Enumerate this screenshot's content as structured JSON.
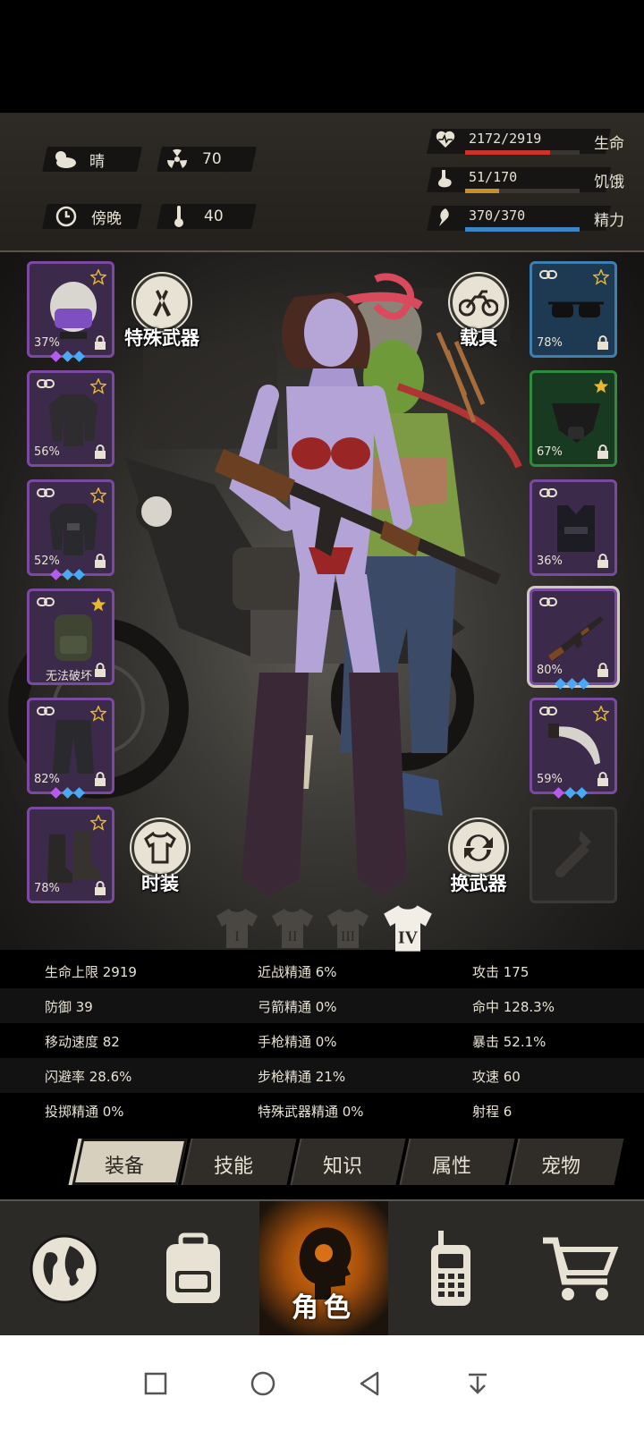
{
  "status": {
    "weather": {
      "icon": "cloud-sun-icon",
      "label": "晴"
    },
    "radiation": {
      "icon": "radiation-icon",
      "value": "70"
    },
    "time": {
      "icon": "clock-icon",
      "label": "傍晚"
    },
    "temperature": {
      "icon": "thermometer-icon",
      "value": "40"
    },
    "vitals": [
      {
        "name": "health",
        "icon": "heart-icon",
        "value": "2172/2919",
        "label": "生命",
        "fraction": 0.744,
        "color": "#c8352b"
      },
      {
        "name": "hunger",
        "icon": "stomach-icon",
        "value": "51/170",
        "label": "饥饿",
        "fraction": 0.3,
        "color": "#c8902b"
      },
      {
        "name": "energy",
        "icon": "energy-icon",
        "value": "370/370",
        "label": "精力",
        "fraction": 1.0,
        "color": "#3c86c8"
      }
    ]
  },
  "actions": {
    "special_weapon": "特殊武器",
    "vehicle": "载具",
    "fashion": "时装",
    "swap_weapon": "换武器"
  },
  "left_slots": [
    {
      "item": "police-helmet",
      "pct": "37%",
      "starred": true,
      "gems": [
        "p",
        "b",
        "b"
      ]
    },
    {
      "item": "jacket",
      "pct": "56%",
      "starred": true,
      "gems": []
    },
    {
      "item": "armored-jacket",
      "pct": "52%",
      "starred": true,
      "gems": [
        "p",
        "b",
        "b"
      ]
    },
    {
      "item": "backpack",
      "note": "无法破坏",
      "starred": true,
      "gems": []
    },
    {
      "item": "pants",
      "pct": "82%",
      "starred": true,
      "gems": [
        "p",
        "b",
        "b"
      ]
    },
    {
      "item": "boots",
      "pct": "78%",
      "starred": true,
      "gems": []
    }
  ],
  "right_slots": [
    {
      "item": "sunglasses",
      "pct": "78%",
      "starred": true,
      "gems": [],
      "tier": "blue"
    },
    {
      "item": "gas-mask",
      "pct": "67%",
      "starred": true,
      "gems": [],
      "tier": "green"
    },
    {
      "item": "police-vest",
      "pct": "36%",
      "starred": false,
      "gems": [],
      "tier": "purple"
    },
    {
      "item": "assault-rifle",
      "pct": "80%",
      "starred": false,
      "gems": [
        "b",
        "b",
        "b"
      ],
      "tier": "purple",
      "selected": true
    },
    {
      "item": "machete",
      "pct": "59%",
      "starred": true,
      "gems": [
        "p",
        "b",
        "b"
      ],
      "tier": "purple"
    },
    {
      "item": "empty-bottle-slot",
      "tier": "empty"
    }
  ],
  "outfits": [
    "I",
    "II",
    "III",
    "IV"
  ],
  "active_outfit": "IV",
  "stats": [
    [
      "生命上限 2919",
      "近战精通 6%",
      "攻击 175"
    ],
    [
      "防御 39",
      "弓箭精通 0%",
      "命中 128.3%"
    ],
    [
      "移动速度 82",
      "手枪精通 0%",
      "暴击 52.1%"
    ],
    [
      "闪避率 28.6%",
      "步枪精通 21%",
      "攻速 60"
    ],
    [
      "投掷精通 0%",
      "特殊武器精通 0%",
      "射程 6"
    ]
  ],
  "tabs": [
    "装备",
    "技能",
    "知识",
    "属性",
    "宠物"
  ],
  "active_tab": "装备",
  "nav": [
    {
      "name": "world",
      "icon": "globe-icon"
    },
    {
      "name": "inventory",
      "icon": "backpack-icon"
    },
    {
      "name": "character",
      "icon": "head-silhouette-icon",
      "label": "角色"
    },
    {
      "name": "radio",
      "icon": "walkie-talkie-icon"
    },
    {
      "name": "shop",
      "icon": "cart-icon"
    }
  ],
  "system_nav": [
    "recent-apps-icon",
    "home-icon",
    "back-icon",
    "notification-pull-icon"
  ]
}
